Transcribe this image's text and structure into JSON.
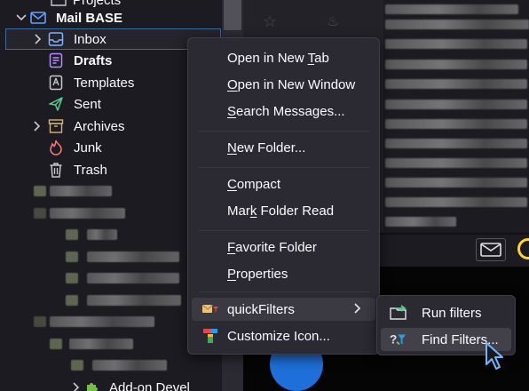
{
  "folder_pane": {
    "top_partial_label": "Projects",
    "account": "Mail BASE",
    "folders": [
      {
        "label": "Inbox",
        "icon": "inbox-icon",
        "has_twisty": true
      },
      {
        "label": "Drafts",
        "icon": "drafts-icon",
        "bold": true
      },
      {
        "label": "Templates",
        "icon": "templates-icon"
      },
      {
        "label": "Sent",
        "icon": "sent-icon"
      },
      {
        "label": "Archives",
        "icon": "archives-icon",
        "has_twisty": true
      },
      {
        "label": "Junk",
        "icon": "junk-icon"
      },
      {
        "label": "Trash",
        "icon": "trash-icon"
      }
    ],
    "bottom_label": "Add-on Devel"
  },
  "context_menu": {
    "items": [
      {
        "label": "Open in New Tab",
        "mnemonic": "T"
      },
      {
        "label": "Open in New Window",
        "mnemonic": "O"
      },
      {
        "label": "Search Messages...",
        "mnemonic": "S"
      },
      {
        "label": "New Folder...",
        "mnemonic": "N"
      },
      {
        "label": "Compact",
        "mnemonic": "C"
      },
      {
        "label": "Mark Folder Read",
        "mnemonic": "k"
      },
      {
        "label": "Favorite Folder",
        "mnemonic": "F"
      },
      {
        "label": "Properties",
        "mnemonic": "P"
      },
      {
        "label": "quickFilters"
      },
      {
        "label": "Customize Icon..."
      }
    ]
  },
  "submenu": {
    "items": [
      {
        "label": "Run filters"
      },
      {
        "label": "Find Filters..."
      }
    ]
  },
  "colors": {
    "accent_blue": "#1e6fd9",
    "menu_bg": "#2b2a33",
    "yellow": "#ffd52a"
  }
}
